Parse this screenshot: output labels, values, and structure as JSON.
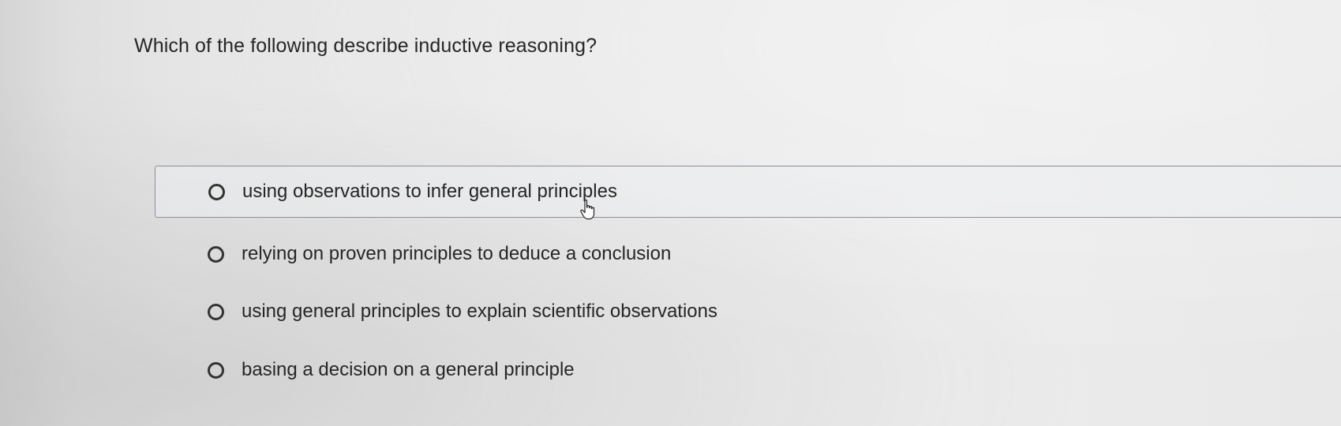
{
  "question": {
    "text": "Which of the following describe inductive reasoning?"
  },
  "options": [
    {
      "label": "using observations to infer general principles",
      "selected": false,
      "hovered": true
    },
    {
      "label": "relying on proven principles to deduce a conclusion",
      "selected": false,
      "hovered": false
    },
    {
      "label": "using general principles to explain scientific observations",
      "selected": false,
      "hovered": false
    },
    {
      "label": "basing a decision on a general principle",
      "selected": false,
      "hovered": false
    }
  ],
  "cursor": {
    "icon": "hand-pointer-icon"
  }
}
